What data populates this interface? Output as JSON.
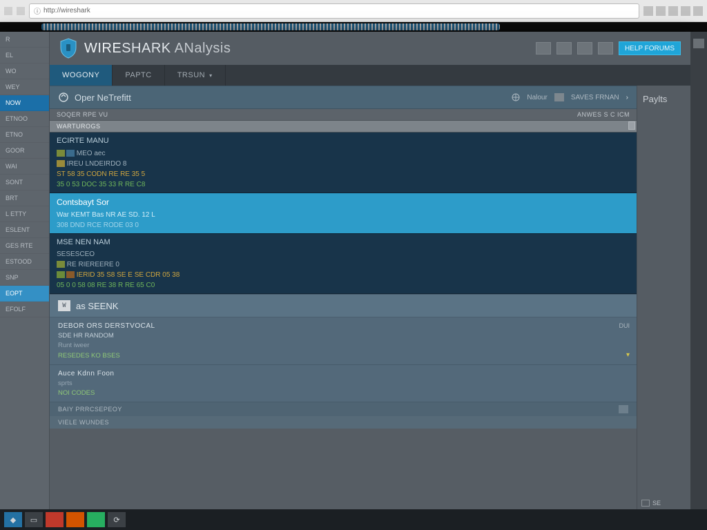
{
  "browser": {
    "url_hint": "http://wireshark"
  },
  "app": {
    "title_a": "WIRE",
    "title_b": "SHARK",
    "title_c": "ANalysis",
    "header_button": "HELP FORUMS"
  },
  "sidebar": {
    "items": [
      {
        "label": "R"
      },
      {
        "label": "EL"
      },
      {
        "label": "WO"
      },
      {
        "label": "WEY"
      },
      {
        "label": "NOW"
      },
      {
        "label": "ETNOO"
      },
      {
        "label": "ETNO"
      },
      {
        "label": "GOOR"
      },
      {
        "label": "WAI"
      },
      {
        "label": "SONT"
      },
      {
        "label": "BRT"
      },
      {
        "label": "L ETTY"
      },
      {
        "label": "ESLENT"
      },
      {
        "label": "GES RTE"
      },
      {
        "label": "ESTOOD"
      },
      {
        "label": "SNP"
      },
      {
        "label": "EOPT"
      },
      {
        "label": "EFOLF"
      }
    ]
  },
  "tabs": [
    {
      "label": "WOGONY",
      "active": true
    },
    {
      "label": "PAPTC",
      "active": false
    },
    {
      "label": "TRSUN",
      "active": false
    }
  ],
  "subheader": {
    "title": "Oper NeTrefitt",
    "right_a": "Nalour",
    "right_b": "SAVES FRNAN"
  },
  "rows": {
    "r1": "SOQER RPE VU",
    "r2": "WARTUROGS",
    "r2_meta": "ANWES S C ICM"
  },
  "packet1": {
    "line1": "ECIRTE MANU",
    "line2": "MEO aec",
    "line3": "IREU LNDEIRDO 8",
    "hex1": "ST 58 35 CODN RE RE 35 5",
    "hex2": "35 0 53 DOC 35 33 R RE C8"
  },
  "highlight": {
    "title": "Contsbayt Sor",
    "sub1": "War KEMT Bas NR AE SD. 12 L",
    "sub2": "308 DND RCE RODE 03 0"
  },
  "packet2": {
    "line1": "MSE NEN NAM",
    "line2": "SESESCEO",
    "line3": "RE RIEREERE 0",
    "hex1": "IERID 35 S8 SE E SE CDR 05 38",
    "hex2": "05 0 0 58 08 RE 38 R RE 65 C0"
  },
  "seek": {
    "badge": "W",
    "label": "as SEENK"
  },
  "detail1": {
    "h": "DEBOR ORS DERSTVOCAL",
    "l1": "SDE HR RANDOM",
    "l2": "Runt iweer",
    "l3": "RESEDES KO BSES",
    "end": "DUI"
  },
  "detail2": {
    "h": "Auce Kdnn Foon",
    "l1": "sprts",
    "l2": "NOI CODES"
  },
  "footer": "BAIY PRRCSEPEOY",
  "footer2": "VIELE WUNDES",
  "rightpane": {
    "title": "Paylts",
    "row1": "SE"
  }
}
